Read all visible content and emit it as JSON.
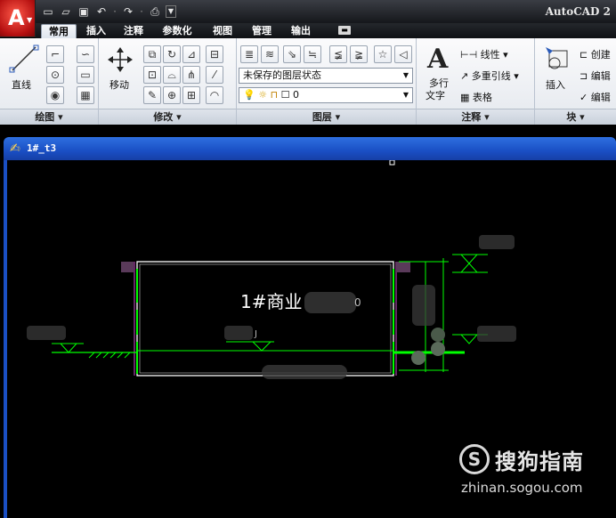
{
  "app": {
    "title": "AutoCAD 2",
    "logo_letter": "A"
  },
  "quick_access": {
    "icons": [
      "new-icon",
      "open-icon",
      "save-icon",
      "undo-icon",
      "redo-icon",
      "plot-icon"
    ]
  },
  "tabs": [
    {
      "label": "常用",
      "active": true
    },
    {
      "label": "插入",
      "active": false
    },
    {
      "label": "注释",
      "active": false
    },
    {
      "label": "参数化",
      "active": false
    },
    {
      "label": "视图",
      "active": false
    },
    {
      "label": "管理",
      "active": false
    },
    {
      "label": "输出",
      "active": false
    }
  ],
  "ribbon": {
    "draw": {
      "title": "绘图",
      "line_label": "直线"
    },
    "modify": {
      "title": "修改",
      "move_label": "移动"
    },
    "layers": {
      "title": "图层",
      "layer_state": "未保存的图层状态",
      "current_layer": "0"
    },
    "annotation": {
      "title": "注释",
      "mtext_label_1": "多行",
      "mtext_label_2": "文字",
      "linear_label": "线性",
      "mleader_label": "多重引线",
      "table_label": "表格"
    },
    "block": {
      "title": "块",
      "insert_label": "插入",
      "create_label": "创建",
      "edit_label": "编辑",
      "edit_attr_label": "编辑"
    }
  },
  "document": {
    "title": "1#_t3",
    "drawing_label": "1#商业",
    "partial_label": "0"
  },
  "watermark": {
    "logo": "S",
    "text": "搜狗指南",
    "url": "zhinan.sogou.com"
  },
  "colors": {
    "cad_green": "#00ff00",
    "cad_white": "#ffffff",
    "cad_magenta": "#ff00ff",
    "titlebar_blue": "#1a4fc4"
  }
}
